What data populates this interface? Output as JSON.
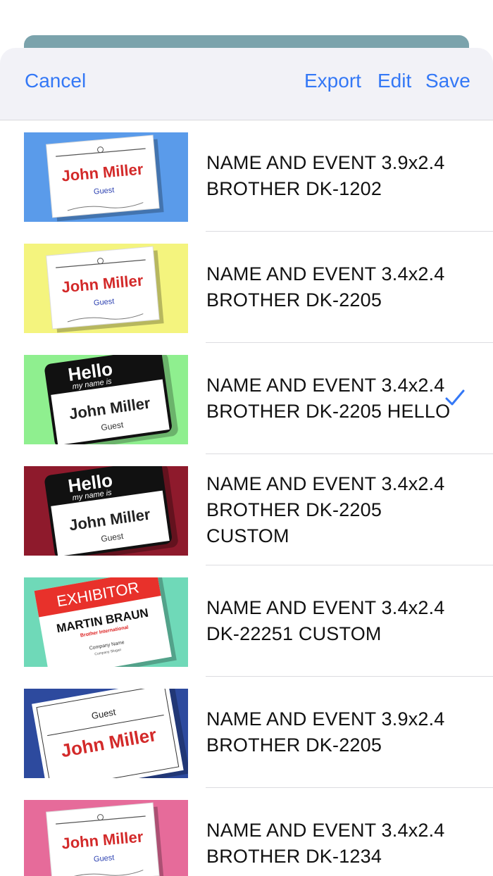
{
  "toolbar": {
    "cancel_label": "Cancel",
    "export_label": "Export",
    "edit_label": "Edit",
    "save_label": "Save"
  },
  "accent_color": "#3478f6",
  "rows": [
    {
      "title": "NAME AND EVENT 3.9x2.4 BROTHER DK-1202",
      "thumb_bg": "#5a9bea",
      "badge_name": "John Miller",
      "badge_sub": "Guest",
      "selected": false
    },
    {
      "title": "NAME AND EVENT 3.4x2.4 BROTHER DK-2205",
      "thumb_bg": "#f4f47e",
      "badge_name": "John Miller",
      "badge_sub": "Guest",
      "selected": false
    },
    {
      "title": "NAME AND EVENT 3.4x2.4 BROTHER DK-2205 HELLO",
      "thumb_bg": "#8fef8f",
      "badge_header": "Hello",
      "badge_header_sub": "my name is",
      "badge_name": "John Miller",
      "badge_sub": "Guest",
      "selected": true
    },
    {
      "title": "NAME AND EVENT 3.4x2.4 BROTHER DK-2205 CUSTOM",
      "thumb_bg": "#8e1a2c",
      "badge_header": "Hello",
      "badge_header_sub": "my name is",
      "badge_name": "John Miller",
      "badge_sub": "Guest",
      "selected": false
    },
    {
      "title": "NAME AND EVENT 3.4x2.4 DK-22251 CUSTOM",
      "thumb_bg": "#6fd9b8",
      "badge_header": "EXHIBITOR",
      "badge_name": "MARTIN BRAUN",
      "badge_company": "Brother International",
      "badge_line1": "Company Name",
      "badge_line2": "Company Slogan",
      "selected": false
    },
    {
      "title": "NAME AND EVENT 3.9x2.4 BROTHER DK-2205",
      "thumb_bg": "#2d4a9e",
      "badge_sub": "Guest",
      "badge_name": "John Miller",
      "selected": false
    },
    {
      "title": "NAME AND EVENT 3.4x2.4 BROTHER DK-1234",
      "thumb_bg": "#e66b9a",
      "badge_name": "John Miller",
      "badge_sub": "Guest",
      "selected": false
    }
  ]
}
